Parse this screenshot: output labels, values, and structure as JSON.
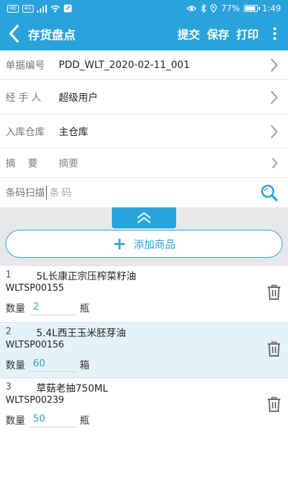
{
  "status_bar": {
    "signal_badge_1": "HD",
    "signal_badge_2": "4G",
    "battery": "77%",
    "battery_level": 0.77,
    "time": "1:49"
  },
  "app_bar": {
    "title": "存货盘点",
    "actions": [
      "提交",
      "保存",
      "打印"
    ]
  },
  "form": {
    "doc_no": {
      "label": "单据编号",
      "value": "PDD_WLT_2020-02-11_001"
    },
    "handler": {
      "label": "经 手 人",
      "value": "超级用户"
    },
    "warehouse": {
      "label": "入库仓库",
      "value": "主仓库"
    },
    "summary": {
      "label": "摘    要",
      "placeholder": "摘要"
    },
    "barcode": {
      "label": "条码扫描",
      "placeholder": "条码"
    }
  },
  "add_button": {
    "label": "添加商品"
  },
  "items": [
    {
      "index": "1",
      "name": "5L长康正宗压榨菜籽油",
      "code": "WLTSP00155",
      "qty_label": "数量",
      "qty": "2",
      "unit": "瓶"
    },
    {
      "index": "2",
      "name": "5.4L西王玉米胚芽油",
      "code": "WLTSP00156",
      "qty_label": "数量",
      "qty": "60",
      "unit": "箱"
    },
    {
      "index": "3",
      "name": "草菇老抽750ML",
      "code": "WLTSP00239",
      "qty_label": "数量",
      "qty": "50",
      "unit": "瓶"
    }
  ],
  "colors": {
    "primary": "#2aa3dc",
    "highlight_row": "#e6f2fa",
    "panel_bg": "#e6e8ea"
  },
  "icons": [
    "back-arrow-icon",
    "more-vert-icon",
    "chevron-right-icon",
    "search-icon",
    "double-chevron-up-icon",
    "plus-icon",
    "trash-icon"
  ]
}
